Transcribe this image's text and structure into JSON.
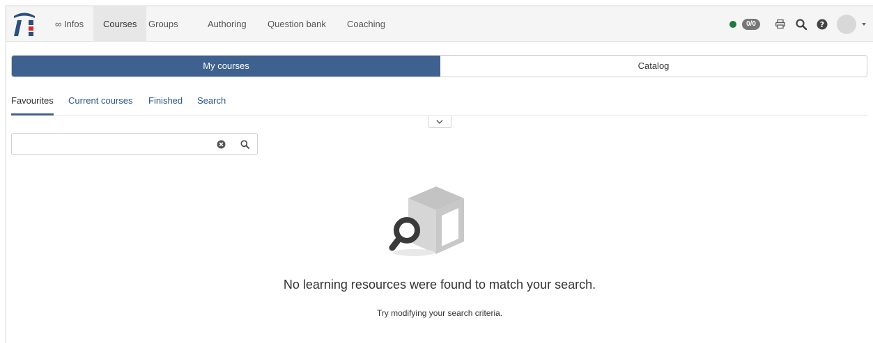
{
  "nav": {
    "items": [
      {
        "label": "∞ Infos",
        "active": false
      },
      {
        "label": "Courses",
        "active": true
      },
      {
        "label": "Groups",
        "active": false
      },
      {
        "label": "Authoring",
        "active": false
      },
      {
        "label": "Question bank",
        "active": false
      },
      {
        "label": "Coaching",
        "active": false
      }
    ],
    "badge": "0/0",
    "status_color": "#1e7a3e",
    "icons": [
      "print-icon",
      "search-icon",
      "help-icon",
      "avatar",
      "caret-down-icon"
    ]
  },
  "switch": {
    "my_courses": "My courses",
    "catalog": "Catalog",
    "accent": "#3e618f"
  },
  "tabs": [
    {
      "label": "Favourites",
      "active": true
    },
    {
      "label": "Current courses",
      "active": false
    },
    {
      "label": "Finished",
      "active": false
    },
    {
      "label": "Search",
      "active": false
    }
  ],
  "search": {
    "value": "",
    "placeholder": ""
  },
  "empty": {
    "title": "No learning resources were found to match your search.",
    "subtitle": "Try modifying your search criteria."
  }
}
